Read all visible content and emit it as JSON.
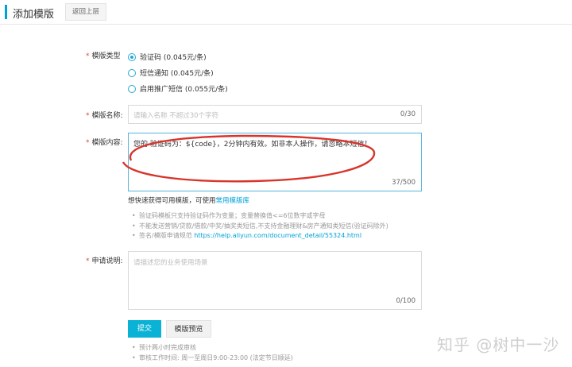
{
  "header": {
    "title": "添加模版",
    "back_label": "返回上层"
  },
  "form": {
    "type_label": "模版类型",
    "type_options": [
      {
        "label": "验证码 (0.045元/条)",
        "selected": true
      },
      {
        "label": "短信通知 (0.045元/条)",
        "selected": false
      },
      {
        "label": "启用推广短信 (0.055元/条)",
        "selected": false
      }
    ],
    "name_label": "模版名称:",
    "name_placeholder": "请输入名称 不超过30个字符",
    "name_count": "0/30",
    "content_label": "模版内容:",
    "content_value": "您的 验证码为：${code}，2分钟内有效。如非本人操作，请忽略本短信！",
    "content_count": "37/500",
    "quick_hint_prefix": "想快速获得可用模版，可使用",
    "quick_hint_link": "常用模版库",
    "rules": [
      "验证码模板只支持验证码作为变量；变量替换值<=6位数字或字母",
      "不能发送营销/贷款/借款/中奖/抽奖类短信,不支持金融理财&房产通知类短信(验证码除外)"
    ],
    "rule3_prefix": "签名/模版申请规范",
    "rule3_link": "https://help.aliyun.com/document_detail/55324.html",
    "reason_label": "申请说明:",
    "reason_placeholder": "请描述您的业务使用场景",
    "reason_count": "0/100",
    "submit_label": "提交",
    "preview_label": "模版预览",
    "notes": [
      "预计两小时完成审核",
      "审核工作时间: 周一至周日9:00-23:00 (法定节日顺延)"
    ]
  },
  "watermark": {
    "text": "知乎 @树中一沙"
  },
  "colors": {
    "accent": "#00a1d6",
    "required": "#e0443b",
    "annotation": "#d8342b"
  }
}
